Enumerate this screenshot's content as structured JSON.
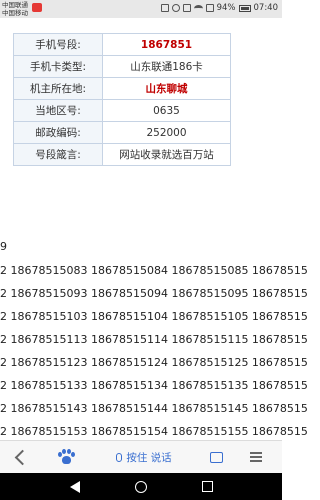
{
  "status_bar": {
    "carrier_line1": "中国联通",
    "carrier_line2": "中国移动",
    "battery": "94%",
    "time": "07:40"
  },
  "info_table": [
    {
      "label": "手机号段:",
      "value": "1867851",
      "highlight": true
    },
    {
      "label": "手机卡类型:",
      "value": "山东联通186卡",
      "highlight": false
    },
    {
      "label": "机主所在地:",
      "value": "山东聊城",
      "highlight": true
    },
    {
      "label": "当地区号:",
      "value": "0635",
      "highlight": false
    },
    {
      "label": "邮政编码:",
      "value": "252000",
      "highlight": false
    },
    {
      "label": "号段箴言:",
      "value": "网站收录就选百万站",
      "highlight": false
    }
  ],
  "number_prefix_fragment": "9",
  "number_lines": [
    "2 18678515083 18678515084 18678515085 18678515",
    "2 18678515093 18678515094 18678515095 18678515",
    "2 18678515103 18678515104 18678515105 18678515",
    "2 18678515113 18678515114 18678515115 18678515",
    "2 18678515123 18678515124 18678515125 18678515",
    "2 18678515133 18678515134 18678515135 18678515",
    "2 18678515143 18678515144 18678515145 18678515",
    "2 18678515153 18678515154 18678515155 18678515"
  ],
  "toolbar": {
    "voice_label": "按住 说话"
  }
}
